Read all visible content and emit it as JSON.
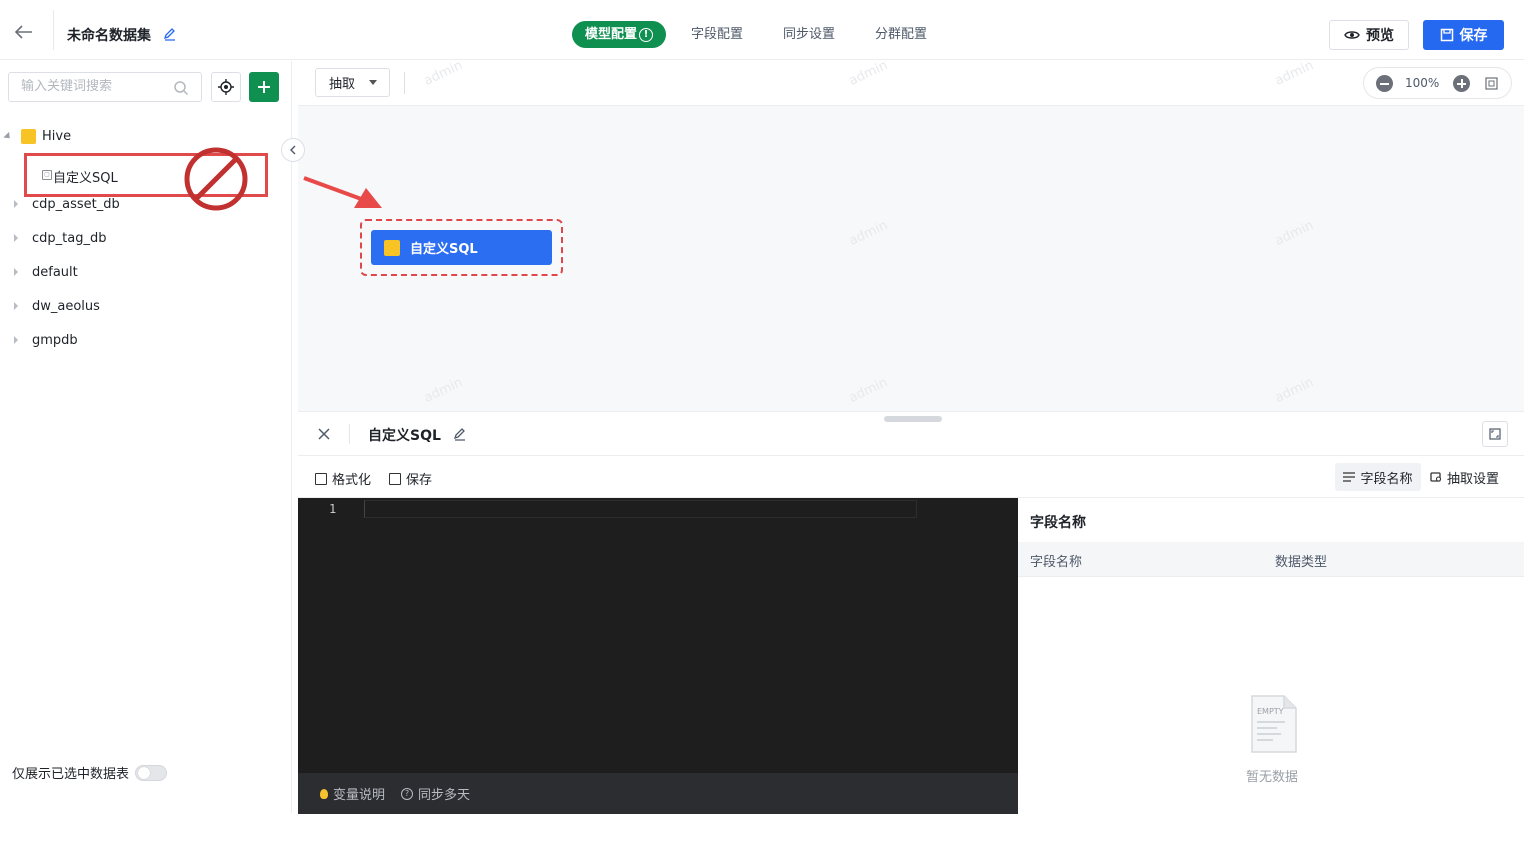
{
  "header": {
    "dataset_title": "未命名数据集",
    "steps": [
      {
        "label": "模型配置",
        "active": true
      },
      {
        "label": "字段配置",
        "active": false
      },
      {
        "label": "同步设置",
        "active": false
      },
      {
        "label": "分群配置",
        "active": false
      }
    ],
    "preview_label": "预览",
    "save_label": "保存",
    "accent_color": "#2469f0",
    "active_step_color": "#0f8f50"
  },
  "sidebar": {
    "search_placeholder": "输入关键词搜索",
    "tree": {
      "root_label": "Hive",
      "selected_item": "自定义SQL",
      "databases": [
        "cdp_asset_db",
        "cdp_tag_db",
        "default",
        "dw_aeolus",
        "gmpdb"
      ]
    },
    "only_selected_label": "仅展示已选中数据表",
    "only_selected_on": false
  },
  "canvas": {
    "extract_select": "抽取",
    "zoom_label": "100%",
    "node_label": "自定义SQL",
    "watermark": "admin"
  },
  "panel": {
    "title": "自定义SQL",
    "format_label": "格式化",
    "save_label": "保存",
    "field_name_tab": "字段名称",
    "extract_settings_tab": "抽取设置",
    "editor_line": "1",
    "footer_var_help": "变量说明",
    "footer_sync_days": "同步多天",
    "fields_title": "字段名称",
    "columns": [
      "字段名称",
      "数据类型"
    ],
    "empty_icon_text": "EMPTY",
    "empty_text": "暂无数据"
  }
}
